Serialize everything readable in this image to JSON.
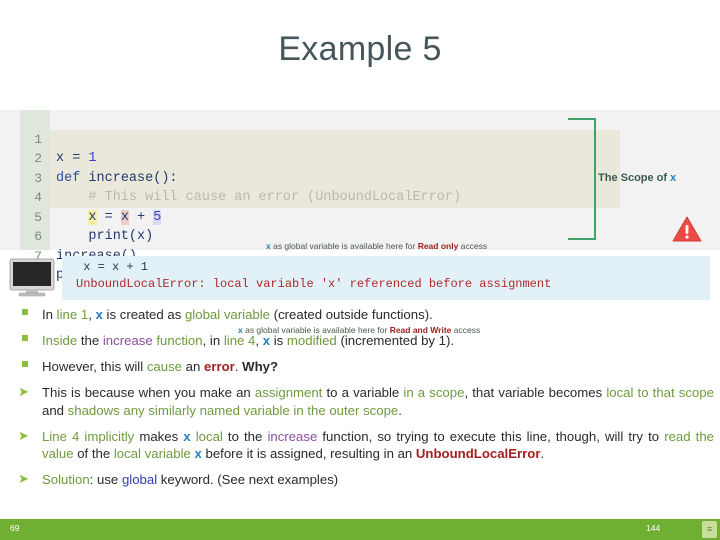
{
  "slide": {
    "title": "Example 5"
  },
  "code": {
    "lines": [
      {
        "no": "1",
        "text": "x = 1"
      },
      {
        "no": "2",
        "text": "def increase():"
      },
      {
        "no": "3",
        "text": "    # This will cause an error (UnboundLocalError)"
      },
      {
        "no": "4",
        "text": "    x = x + 5"
      },
      {
        "no": "5",
        "text": "    print(x)"
      },
      {
        "no": "6",
        "text": "increase()"
      },
      {
        "no": "7",
        "text": "print(x)"
      }
    ],
    "annotation_read_only": {
      "var": "x",
      "mid": " as global variable is available here for ",
      "access": "Read only",
      "tail": " access"
    },
    "annotation_read_write": {
      "var": "x",
      "mid": " as global variable is available here for ",
      "access": "Read and Write",
      "tail": " access"
    },
    "scope_label": {
      "text": "The Scope of ",
      "var": "x"
    }
  },
  "console": {
    "line1": " x = x + 1",
    "line2": "UnboundLocalError: local variable 'x' referenced before assignment"
  },
  "bullets": [
    {
      "marker": "square",
      "parts": [
        {
          "t": "In ",
          "c": "plain"
        },
        {
          "t": "line 1",
          "c": "green"
        },
        {
          "t": ", ",
          "c": "plain"
        },
        {
          "t": "x",
          "c": "blue"
        },
        {
          "t": " is created as ",
          "c": "plain"
        },
        {
          "t": "global variable",
          "c": "green"
        },
        {
          "t": " (created outside functions).",
          "c": "plain"
        }
      ]
    },
    {
      "marker": "square",
      "parts": [
        {
          "t": "Inside",
          "c": "green"
        },
        {
          "t": " the ",
          "c": "plain"
        },
        {
          "t": "increase",
          "c": "purple"
        },
        {
          "t": " function",
          "c": "green"
        },
        {
          "t": ", in ",
          "c": "plain"
        },
        {
          "t": "line 4",
          "c": "green"
        },
        {
          "t": ", ",
          "c": "plain"
        },
        {
          "t": "x",
          "c": "blue"
        },
        {
          "t": " is ",
          "c": "plain"
        },
        {
          "t": "modified",
          "c": "green"
        },
        {
          "t": " (incremented by 1).",
          "c": "plain"
        }
      ]
    },
    {
      "marker": "square",
      "parts": [
        {
          "t": "However, this will ",
          "c": "plain"
        },
        {
          "t": "cause",
          "c": "green"
        },
        {
          "t": " an ",
          "c": "plain"
        },
        {
          "t": "error",
          "c": "red"
        },
        {
          "t": ". ",
          "c": "plain"
        },
        {
          "t": "Why?",
          "c": "bold"
        }
      ]
    },
    {
      "marker": "arrow",
      "parts": [
        {
          "t": "This is because when you make an ",
          "c": "plain"
        },
        {
          "t": "assignment",
          "c": "green"
        },
        {
          "t": " to a variable ",
          "c": "plain"
        },
        {
          "t": "in a scope",
          "c": "green"
        },
        {
          "t": ", that variable becomes ",
          "c": "plain"
        },
        {
          "t": "local to that scope",
          "c": "green"
        },
        {
          "t": " and ",
          "c": "plain"
        },
        {
          "t": "shadows any similarly named variable in the outer scope",
          "c": "green"
        },
        {
          "t": ".",
          "c": "plain"
        }
      ]
    },
    {
      "marker": "arrow",
      "parts": [
        {
          "t": "Line 4 implicitly",
          "c": "green"
        },
        {
          "t": " makes ",
          "c": "plain"
        },
        {
          "t": "x",
          "c": "blue"
        },
        {
          "t": " ",
          "c": "plain"
        },
        {
          "t": "local",
          "c": "green"
        },
        {
          "t": " to the ",
          "c": "plain"
        },
        {
          "t": "increase",
          "c": "purple"
        },
        {
          "t": " function, so trying to execute this line, though, will try to ",
          "c": "plain"
        },
        {
          "t": "read the value",
          "c": "green"
        },
        {
          "t": " of the ",
          "c": "plain"
        },
        {
          "t": "local variable",
          "c": "green"
        },
        {
          "t": " ",
          "c": "plain"
        },
        {
          "t": "x",
          "c": "blue"
        },
        {
          "t": " before it is assigned, resulting in an ",
          "c": "plain"
        },
        {
          "t": "UnboundLocalError",
          "c": "red"
        },
        {
          "t": ".",
          "c": "plain"
        }
      ]
    },
    {
      "marker": "arrow",
      "parts": [
        {
          "t": "Solution",
          "c": "green"
        },
        {
          "t": ": use ",
          "c": "plain"
        },
        {
          "t": "global",
          "c": "bluebold"
        },
        {
          "t": " keyword. (See next examples)",
          "c": "plain"
        }
      ]
    }
  ],
  "footer": {
    "left_number": "69",
    "right_number": "144",
    "badge": "≡"
  },
  "colors": {
    "accent_green": "#6fb033",
    "bullet_green": "#8cbf3f",
    "title_gray": "#47565a",
    "error_red": "#b02828",
    "var_blue": "#2a7fc0",
    "bracket_green": "#43a06a",
    "console_bg": "#e2f1f8",
    "code_bg": "#f2f2f2",
    "func_body_bg": "#e9e8da"
  }
}
